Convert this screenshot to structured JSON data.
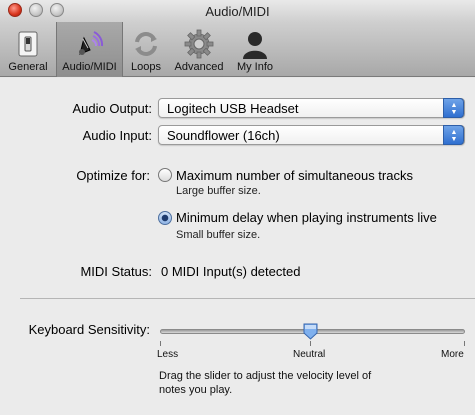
{
  "window": {
    "title": "Audio/MIDI"
  },
  "toolbar": {
    "items": [
      {
        "label": "General",
        "icon": "switch-icon"
      },
      {
        "label": "Audio/MIDI",
        "icon": "audio-midi-icon",
        "selected": true
      },
      {
        "label": "Loops",
        "icon": "loops-icon"
      },
      {
        "label": "Advanced",
        "icon": "gear-icon"
      },
      {
        "label": "My Info",
        "icon": "person-icon"
      }
    ]
  },
  "audio": {
    "output_label": "Audio Output:",
    "output_value": "Logitech USB Headset",
    "input_label": "Audio Input:",
    "input_value": "Soundflower (16ch)"
  },
  "optimize": {
    "label": "Optimize for:",
    "options": [
      {
        "title": "Maximum number of simultaneous tracks",
        "subtitle": "Large buffer size.",
        "checked": false
      },
      {
        "title": "Minimum delay when playing instruments live",
        "subtitle": "Small buffer size.",
        "checked": true
      }
    ]
  },
  "midi": {
    "label": "MIDI Status:",
    "value": "0 MIDI Input(s) detected"
  },
  "keyboard": {
    "label": "Keyboard Sensitivity:",
    "level": 0.5,
    "ticks": [
      "Less",
      "Neutral",
      "More"
    ],
    "help": "Drag the slider to adjust the velocity level of notes you play."
  },
  "colors": {
    "accent": "#3a78d6",
    "background": "#ebebeb"
  }
}
